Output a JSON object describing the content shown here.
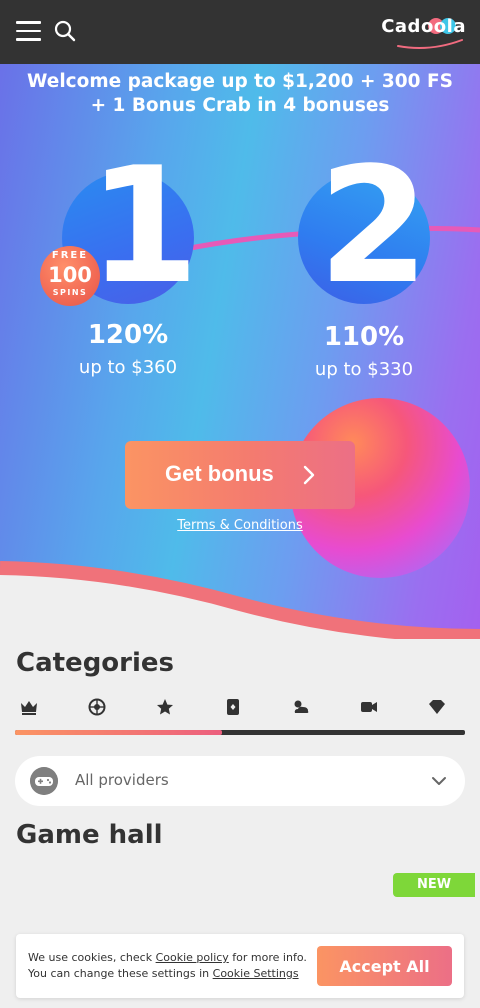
{
  "header": {
    "logo_text": "Cadoola"
  },
  "hero": {
    "title": "Welcome package up to $1,200 + 300 FS + 1 Bonus Crab in 4 bonuses",
    "bonuses": [
      {
        "number": "1",
        "percent": "120%",
        "up_to": "up to $360"
      },
      {
        "number": "2",
        "percent": "110%",
        "up_to": "up to $330"
      }
    ],
    "free_badge": {
      "top": "FREE",
      "count": "100",
      "bottom": "SPINS"
    },
    "cta_label": "Get bonus",
    "terms_label": "Terms & Conditions"
  },
  "categories": {
    "title": "Categories",
    "icons": [
      "crown-icon",
      "roulette-icon",
      "star-icon",
      "card-icon",
      "weather-icon",
      "camera-icon",
      "heart-icon"
    ],
    "scroll_progress": 0.46
  },
  "providers": {
    "label": "All providers"
  },
  "game_hall": {
    "title": "Game hall",
    "badge": "NEW"
  },
  "cookie": {
    "line1_prefix": "We use cookies, check ",
    "policy_link": "Cookie policy",
    "line1_suffix": " for more info.",
    "line2_prefix": "You can change these settings in ",
    "settings_link": "Cookie Settings",
    "accept_label": "Accept All"
  },
  "colors": {
    "header_bg": "#333333",
    "accent_orange": "#fb9463",
    "accent_pink": "#ec6f86",
    "new_badge": "#7ed739"
  }
}
